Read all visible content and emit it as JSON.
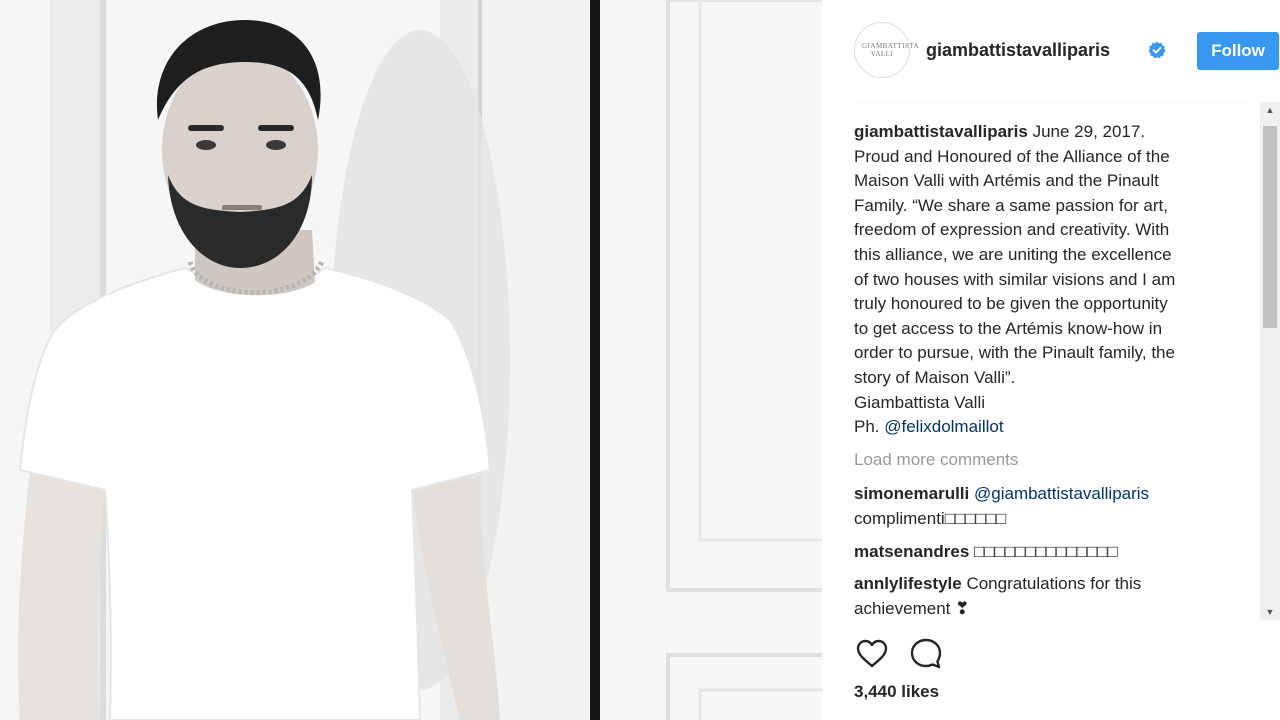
{
  "post": {
    "username": "giambattistavalliparis",
    "follow_label": "Follow",
    "avatar_text": "GIAMBATTISTA VALLI",
    "caption": {
      "username": "giambattistavalliparis",
      "lines": [
        " June 29, 2017.",
        "Proud and Honoured of the Alliance of the",
        "Maison Valli with Artémis and the Pinault",
        "Family. “We share a same passion for art,",
        "freedom of expression and creativity. With",
        "this alliance, we are uniting the excellence",
        "of two houses with similar visions and I am",
        "truly honoured to be given the opportunity",
        "to get access to the Artémis know-how in",
        "order to pursue, with the Pinault family, the",
        "story of Maison Valli”.",
        "Giambattista Valli"
      ],
      "photo_credit_prefix": "Ph. ",
      "photo_credit_handle": "@felixdolmaillot"
    },
    "load_more": "Load more comments",
    "comments": [
      {
        "username": "simonemarulli",
        "mention": "@giambattistavalliparis",
        "text": "complimenti□□□□□□"
      },
      {
        "username": "matsenandres",
        "mention": "",
        "text": "□□□□□□□□□□□□□□"
      },
      {
        "username": "annlylifestyle",
        "mention": "",
        "text": "Congratulations for this achievement ❣"
      }
    ],
    "likes": "3,440 likes",
    "icons": {
      "like": "heart-icon",
      "comment": "comment-icon",
      "verified": "verified-badge-icon"
    },
    "colors": {
      "accent": "#3897f0",
      "link": "#003569",
      "muted": "#999999"
    }
  }
}
